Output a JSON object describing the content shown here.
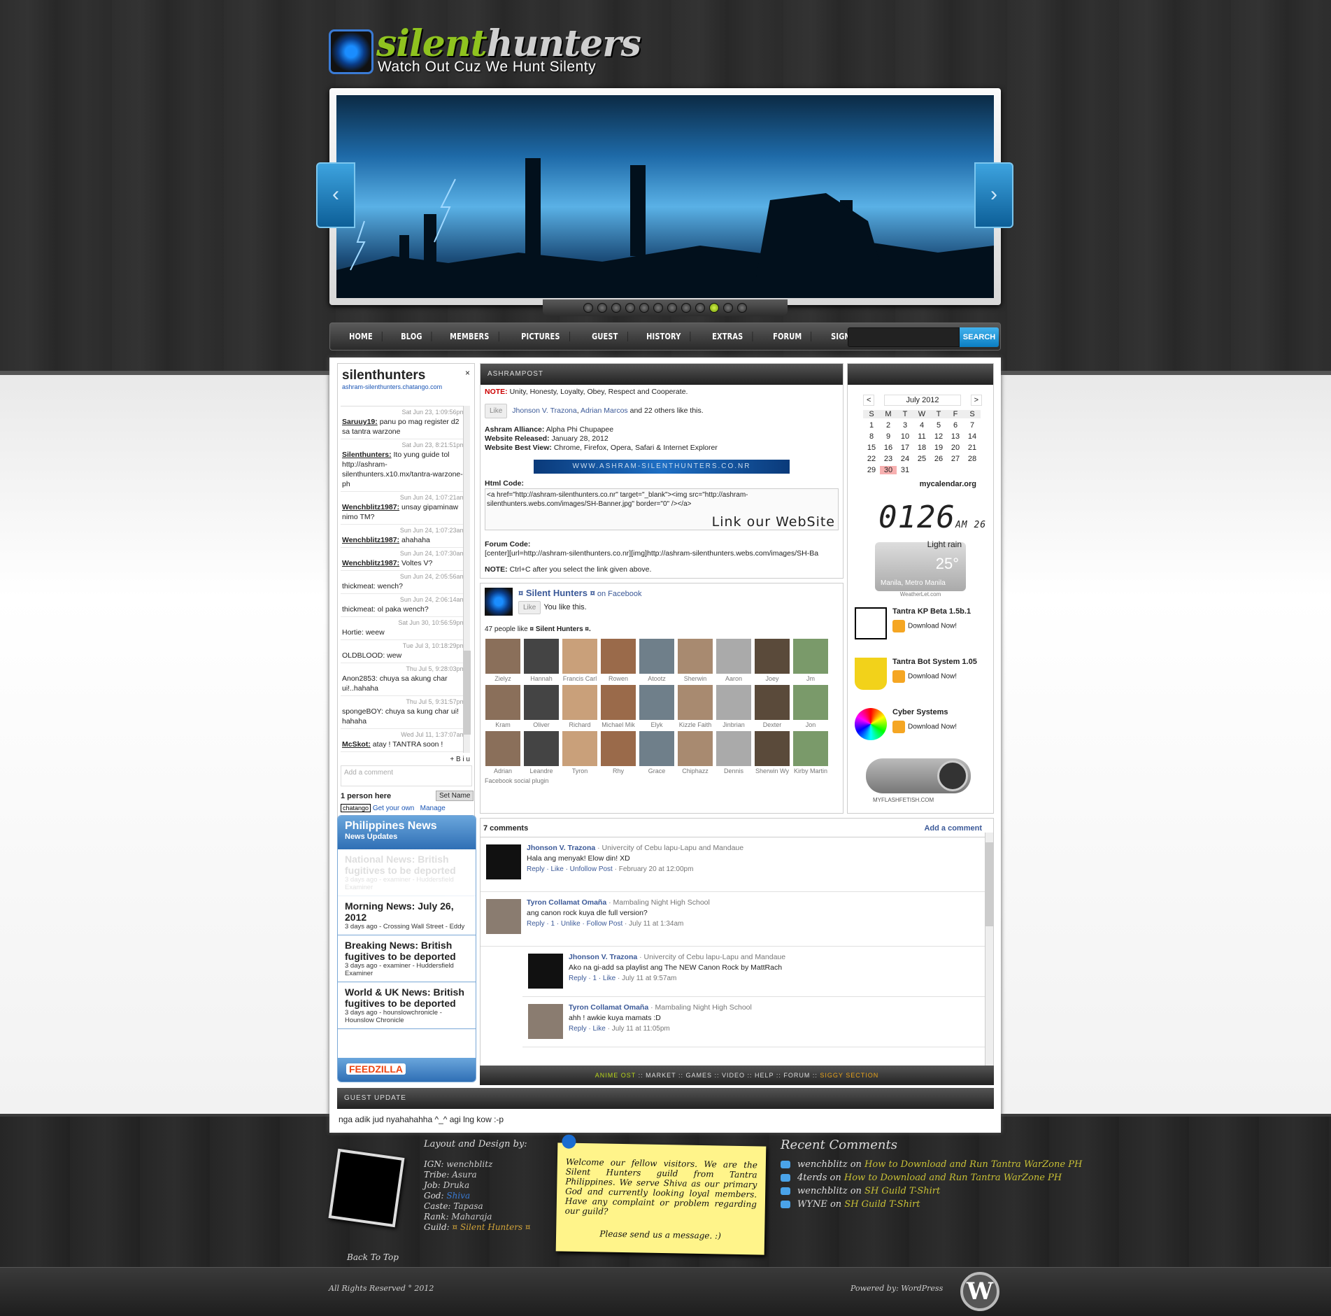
{
  "logo": {
    "title_a": "silent",
    "title_b": "hunters",
    "tagline": "Watch Out Cuz We Hunt Silenty"
  },
  "nav": {
    "items": [
      "HOME",
      "BLOG",
      "MEMBERS",
      "PICTURES",
      "GUEST",
      "HISTORY",
      "EXTRAS",
      "FORUM",
      "SIGNATURES"
    ],
    "search_label": "SEARCH"
  },
  "chat": {
    "title": "silenthunters",
    "url": "ashram-silenthunters.chatango.com",
    "messages": [
      {
        "time": "Sat Jun 23, 1:09:56pm",
        "user": "Saruuy19:",
        "text": "panu po mag register d2 sa tantra warzone"
      },
      {
        "time": "Sat Jun 23, 8:21:51pm",
        "user": "Silenthunters:",
        "text": "Ito yung guide tol http://ashram-silenthunters.x10.mx/tantra-warzone-ph"
      },
      {
        "time": "Sun Jun 24, 1:07:21am",
        "user": "Wenchblitz1987:",
        "text": "unsay gipaminaw nimo TM?"
      },
      {
        "time": "Sun Jun 24, 1:07:23am",
        "user": "Wenchblitz1987:",
        "text": "ahahaha"
      },
      {
        "time": "Sun Jun 24, 1:07:30am",
        "user": "Wenchblitz1987:",
        "text": "Voltes V?"
      },
      {
        "time": "Sun Jun 24, 2:05:56am",
        "user": "",
        "text": "thickmeat: wench?"
      },
      {
        "time": "Sun Jun 24, 2:06:14am",
        "user": "",
        "text": "thickmeat: ol paka wench?"
      },
      {
        "time": "Sat Jun 30, 10:56:59pm",
        "user": "",
        "text": "Hortie: weew"
      },
      {
        "time": "Tue Jul 3, 10:18:29pm",
        "user": "",
        "text": "OLDBLOOD: wew"
      },
      {
        "time": "Thu Jul 5, 9:28:03pm",
        "user": "",
        "text": "Anon2853: chuya sa akung char ui!..hahaha"
      },
      {
        "time": "Thu Jul 5, 9:31:57pm",
        "user": "",
        "text": "spongeBOY: chuya sa kung char ui! hahaha"
      },
      {
        "time": "Wed Jul 11, 1:37:07am",
        "user": "McSkot:",
        "text": "atay ! TANTRA soon !"
      }
    ],
    "tools": "+ B i u",
    "input_placeholder": "Add a comment",
    "people": "1 person here",
    "set_name": "Set Name",
    "brand": "chatango",
    "get_own": "Get your own",
    "manage": "Manage"
  },
  "news": {
    "title": "Philippines News",
    "subtitle": "News Updates",
    "items": [
      {
        "headline": "National News: British fugitives to be deported",
        "meta": "3 days ago - examiner - Huddersfield Examiner",
        "faded": true
      },
      {
        "headline": "Morning News: July 26, 2012",
        "meta": "3 days ago - Crossing Wall Street - Eddy"
      },
      {
        "headline": "Breaking News: British fugitives to be deported",
        "meta": "3 days ago - examiner - Huddersfield Examiner"
      },
      {
        "headline": "World & UK News: British fugitives to be deported",
        "meta": "3 days ago - hounslowchronicle - Hounslow Chronicle"
      }
    ],
    "brand": "FEEDZILLA"
  },
  "post": {
    "header": "ASHRAMPOST",
    "note_label": "NOTE:",
    "note": "Unity, Honesty, Loyalty, Obey, Respect and Cooperate.",
    "like": "Like",
    "like_names_a": "Jhonson V. Trazona",
    "like_names_b": "Adrian Marcos",
    "like_rest": "and 22 others like this.",
    "alliance_label": "Ashram Alliance:",
    "alliance": "Alpha Phi Chupapee",
    "released_label": "Website Released:",
    "released": "January 28, 2012",
    "best_label": "Website Best View:",
    "best": "Chrome, Firefox, Opera, Safari & Internet Explorer",
    "banner_text": "WWW.ASHRAM-SILENTHUNTERS.CO.NR",
    "html_label": "Html Code:",
    "html_code": "<a href=\"http://ashram-silenthunters.co.nr\" target=\"_blank\"><img src=\"http://ashram-silenthunters.webs.com/images/SH-Banner.jpg\" border=\"0\" /></a>",
    "link_site": "Link our WebSite",
    "forum_label": "Forum Code:",
    "forum_code": "[center][url=http://ashram-silenthunters.co.nr][img]http://ashram-silenthunters.webs.com/images/SH-Ba",
    "note2_label": "NOTE:",
    "note2": "Ctrl+C after you select the link given above."
  },
  "fb": {
    "page_name": "¤ Silent Hunters ¤",
    "on_fb": "on Facebook",
    "like": "Like",
    "you_like": "You like this.",
    "count_prefix": "47 people like",
    "count_name": "¤ Silent Hunters ¤.",
    "people": [
      "Zielyz",
      "Hannah",
      "Francis Carl",
      "Rowen",
      "Atootz",
      "Sherwin",
      "Aaron",
      "Joey",
      "Jm",
      "Kram",
      "Oliver",
      "Richard",
      "Michael Mik",
      "Elyk",
      "Kizzle Faith",
      "Jinbrian",
      "Dexter",
      "Jon",
      "Adrian",
      "Leandre",
      "Tyron",
      "Rhy",
      "Grace",
      "Chiphazz",
      "Dennis",
      "Sherwin Wy",
      "Kirby Martin"
    ],
    "plugin": "Facebook social plugin"
  },
  "calendar": {
    "month": "July 2012",
    "prev": "<",
    "next": ">",
    "days": [
      "S",
      "M",
      "T",
      "W",
      "T",
      "F",
      "S"
    ],
    "dates": [
      "",
      "",
      "",
      "",
      "",
      "",
      "",
      "1",
      "2",
      "3",
      "4",
      "5",
      "6",
      "7",
      "8",
      "9",
      "10",
      "11",
      "12",
      "13",
      "14",
      "15",
      "16",
      "17",
      "18",
      "19",
      "20",
      "21",
      "22",
      "23",
      "24",
      "25",
      "26",
      "27",
      "28",
      "29",
      "30",
      "31",
      "",
      "",
      "",
      ""
    ],
    "today": "30",
    "source": "mycalendar.org"
  },
  "clock": {
    "time": "0126",
    "ampm": "AM",
    "sec": "26"
  },
  "weather": {
    "condition": "Light rain",
    "temp": "25°",
    "location": "Manila, Metro Manila",
    "source": "WeatherLet.com"
  },
  "downloads": [
    {
      "name": "Tantra KP Beta 1.5b.1",
      "btn": "Download Now!"
    },
    {
      "name": "Tantra Bot System 1.05",
      "btn": "Download Now!"
    },
    {
      "name": "Cyber Systems",
      "btn": "Download Now!"
    }
  ],
  "player": {
    "label": "MYFLASHFETISH.COM"
  },
  "comments": {
    "count": "7 comments",
    "add": "Add a comment",
    "items": [
      {
        "name": "Jhonson V. Trazona",
        "school": "· Univercity of Cebu lapu-Lapu and Mandaue",
        "text": "Hala ang menyak! Elow din! XD",
        "actions": "Reply · Like · Unfollow Post",
        "time": "· February 20 at 12:00pm"
      },
      {
        "name": "Tyron Collamat Omaña",
        "school": "· Mambaling Night High School",
        "text": "ang canon rock kuya dle full version?",
        "actions": "Reply · 1 · Unlike · Follow Post",
        "time": "· July 11 at 1:34am"
      },
      {
        "name": "Jhonson V. Trazona",
        "school": "· Univercity of Cebu lapu-Lapu and Mandaue",
        "text": "Ako na gi-add sa playlist ang The NEW Canon Rock by MattRach",
        "actions": "Reply · 1 · Like",
        "time": "· July 11 at 9:57am",
        "reply": true
      },
      {
        "name": "Tyron Collamat Omaña",
        "school": "· Mambaling Night High School",
        "text": "ahh ! awkie kuya mamats :D",
        "actions": "Reply · Like",
        "time": "· July 11 at 11:05pm",
        "reply": true
      }
    ]
  },
  "subnav": {
    "a": "ANIME OST",
    "b": "MARKET",
    "c": "GAMES",
    "d": "VIDEO",
    "e": "HELP",
    "f": "FORUM",
    "g": "SIGGY SECTION"
  },
  "guest": {
    "header": "GUEST UPDATE",
    "message": "nga adik jud nyahahahha ^_^ agi lng kow :-p"
  },
  "footer": {
    "design_title": "Layout and Design by:",
    "ign_l": "IGN:",
    "ign": "wenchblitz",
    "tribe_l": "Tribe:",
    "tribe": "Asura",
    "job_l": "Job:",
    "job": "Druka",
    "god_l": "God:",
    "god": "Shiva",
    "caste_l": "Caste:",
    "caste": "Tapasa",
    "rank_l": "Rank:",
    "rank": "Maharaja",
    "guild_l": "Guild:",
    "guild": "¤ Silent Hunters ¤",
    "back_top": "Back To Top",
    "note": "Welcome our fellow visitors. We are the Silent Hunters guild from Tantra Philippines. We serve Shiva as our primary God and currently looking loyal members. Have any complaint or problem regarding our guild?",
    "note_send": "Please send us a message. :)",
    "recent_title": "Recent Comments",
    "recent": [
      {
        "who": "wenchblitz",
        "on": "on",
        "what": "How to Download and Run Tantra WarZone PH"
      },
      {
        "who": "4terds",
        "on": "on",
        "what": "How to Download and Run Tantra WarZone PH"
      },
      {
        "who": "wenchblitz",
        "on": "on",
        "what": "SH Guild T-Shirt"
      },
      {
        "who": "WYNE",
        "on": "on",
        "what": "SH Guild T-Shirt"
      }
    ],
    "copyright": "All Rights Reserved ° 2012",
    "powered": "Powered by: WordPress"
  },
  "colors": {
    "accent": "#0b7ec2",
    "nav_bg": "#2a2a2a",
    "highlight": "#b7d41a",
    "note_bg": "#fff48a"
  }
}
